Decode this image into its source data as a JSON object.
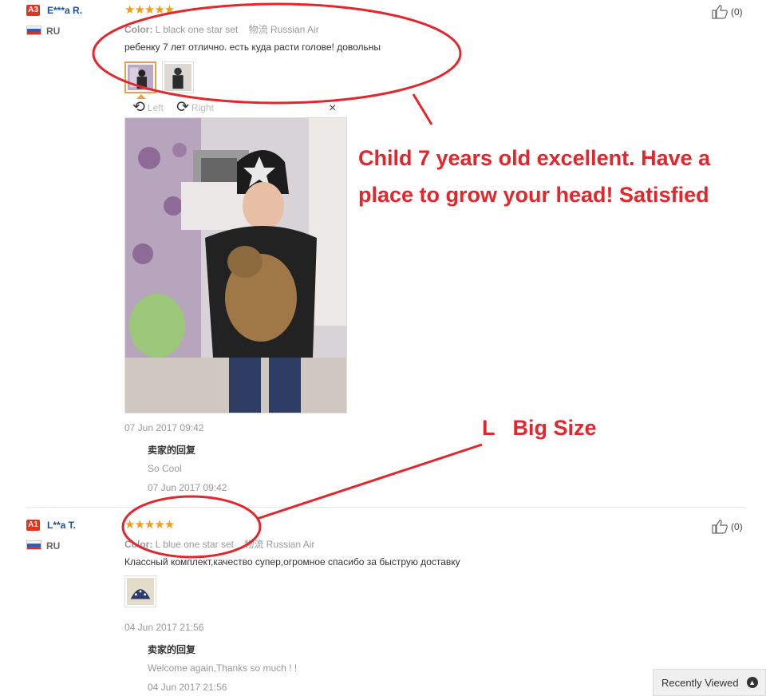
{
  "reviews": [
    {
      "level": "A3",
      "user": "E***a R.",
      "country": "RU",
      "stars": "★★★★★",
      "color_label": "Color:",
      "color_value": "L black one star set",
      "logistics_label": "物流",
      "logistics_value": "Russian Air",
      "text": "ребенку 7 лет отлично. есть куда расти голове! довольны",
      "date": "07 Jun 2017 09:42",
      "reply_title": "卖家的回复",
      "reply_text": "So Cool",
      "reply_date": "07 Jun 2017 09:42",
      "likes": "(0)",
      "viewer": {
        "left": "Left",
        "right": "Right",
        "close": "×"
      }
    },
    {
      "level": "A1",
      "user": "L**a T.",
      "country": "RU",
      "stars": "★★★★★",
      "color_label": "Color:",
      "color_value": "L blue one star set",
      "logistics_label": "物流",
      "logistics_value": "Russian Air",
      "text": "Классный комплект,качество супер,огромное спасибо за быструю доставку",
      "date": "04 Jun 2017 21:56",
      "reply_title": "卖家的回复",
      "reply_text": "Welcome again,Thanks so much ! !",
      "reply_date": "04 Jun 2017 21:56",
      "likes": "(0)"
    }
  ],
  "annotations": {
    "translation_line1": "Child 7 years old excellent. Have a",
    "translation_line2": "place to grow your head! Satisfied",
    "size_note": "L   Big Size"
  },
  "recently_viewed": "Recently Viewed",
  "colors": {
    "annotation": "#e3262c",
    "star": "#f29c1f",
    "badge": "#e3331d",
    "username": "#1a4fa0"
  }
}
